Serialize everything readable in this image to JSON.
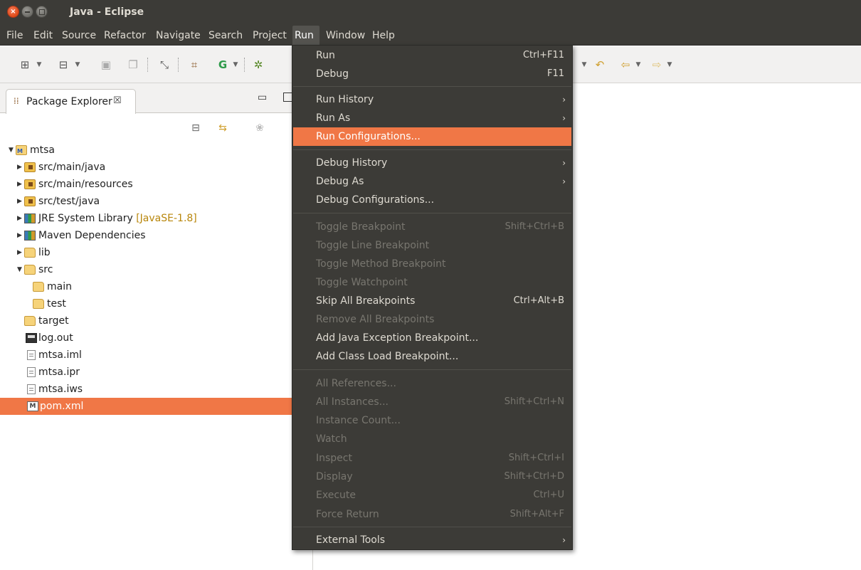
{
  "window": {
    "title": "Java - Eclipse",
    "close_glyph": "×"
  },
  "menubar": [
    {
      "label": "File"
    },
    {
      "label": "Edit"
    },
    {
      "label": "Source"
    },
    {
      "label": "Refactor"
    },
    {
      "label": "Navigate"
    },
    {
      "label": "Search"
    },
    {
      "label": "Project"
    },
    {
      "label": "Run"
    },
    {
      "label": "Window"
    },
    {
      "label": "Help"
    }
  ],
  "package_explorer": {
    "tab_label": "Package Explorer",
    "tab_close": "☒",
    "tree": [
      {
        "label": "mtsa",
        "expanded": true,
        "icon": "project-icon"
      },
      {
        "label": "src/main/java",
        "icon": "package-folder-icon"
      },
      {
        "label": "src/main/resources",
        "icon": "package-folder-icon"
      },
      {
        "label": "src/test/java",
        "icon": "package-folder-icon"
      },
      {
        "label": "JRE System Library",
        "decoration": "[JavaSE-1.8]",
        "icon": "library-icon"
      },
      {
        "label": "Maven Dependencies",
        "icon": "library-icon"
      },
      {
        "label": "lib",
        "icon": "folder-icon"
      },
      {
        "label": "src",
        "expanded": true,
        "icon": "folder-icon"
      },
      {
        "label": "main",
        "icon": "folder-icon"
      },
      {
        "label": "test",
        "icon": "folder-icon"
      },
      {
        "label": "target",
        "icon": "folder-icon"
      },
      {
        "label": "log.out",
        "icon": "log-file-icon"
      },
      {
        "label": "mtsa.iml",
        "icon": "file-icon"
      },
      {
        "label": "mtsa.ipr",
        "icon": "file-icon"
      },
      {
        "label": "mtsa.iws",
        "icon": "file-icon"
      },
      {
        "label": "pom.xml",
        "icon": "maven-file-icon",
        "selected": true
      }
    ]
  },
  "run_menu": {
    "items": [
      {
        "label": "Run",
        "accel": "Ctrl+F11"
      },
      {
        "label": "Debug",
        "accel": "F11"
      },
      {
        "label": "Run History",
        "submenu": "›"
      },
      {
        "label": "Run As",
        "submenu": "›"
      },
      {
        "label": "Run Configurations...",
        "highlight": true
      },
      {
        "label": "Debug History",
        "submenu": "›"
      },
      {
        "label": "Debug As",
        "submenu": "›"
      },
      {
        "label": "Debug Configurations..."
      },
      {
        "label": "Toggle Breakpoint",
        "accel": "Shift+Ctrl+B",
        "disabled": true
      },
      {
        "label": "Toggle Line Breakpoint",
        "disabled": true
      },
      {
        "label": "Toggle Method Breakpoint",
        "disabled": true
      },
      {
        "label": "Toggle Watchpoint",
        "disabled": true
      },
      {
        "label": "Skip All Breakpoints",
        "accel": "Ctrl+Alt+B"
      },
      {
        "label": "Remove All Breakpoints",
        "disabled": true
      },
      {
        "label": "Add Java Exception Breakpoint..."
      },
      {
        "label": "Add Class Load Breakpoint..."
      },
      {
        "label": "All References...",
        "disabled": true
      },
      {
        "label": "All Instances...",
        "accel": "Shift+Ctrl+N",
        "disabled": true
      },
      {
        "label": "Instance Count...",
        "disabled": true
      },
      {
        "label": "Watch",
        "disabled": true
      },
      {
        "label": "Inspect",
        "accel": "Shift+Ctrl+I",
        "disabled": true
      },
      {
        "label": "Display",
        "accel": "Shift+Ctrl+D",
        "disabled": true
      },
      {
        "label": "Execute",
        "accel": "Ctrl+U",
        "disabled": true
      },
      {
        "label": "Force Return",
        "accel": "Shift+Alt+F",
        "disabled": true
      },
      {
        "label": "External Tools",
        "submenu": "›"
      }
    ]
  },
  "colors": {
    "chrome_dark": "#3c3b37",
    "highlight_orange": "#f07746",
    "menu_text": "#dfdbd2",
    "disabled_text": "#78766f"
  }
}
